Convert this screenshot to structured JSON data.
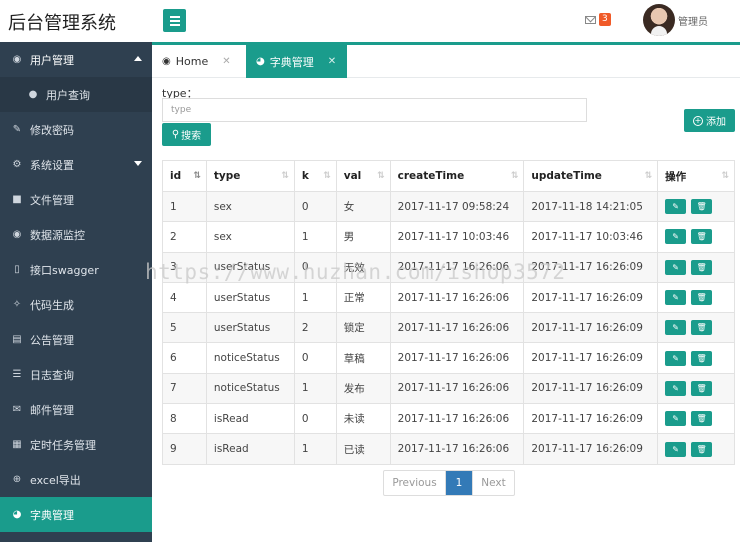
{
  "app": {
    "title": "后台管理系统"
  },
  "header": {
    "mail_count": "3",
    "user_name": "管理员"
  },
  "sidebar": {
    "items": [
      {
        "label": "用户管理",
        "icon": "users-icon",
        "glyph": "👥"
      },
      {
        "label": "用户查询",
        "icon": "user-icon",
        "glyph": "👤"
      },
      {
        "label": "修改密码",
        "icon": "edit-icon",
        "glyph": "✎"
      },
      {
        "label": "系统设置",
        "icon": "gears-icon",
        "glyph": "⚙"
      },
      {
        "label": "文件管理",
        "icon": "folder-icon",
        "glyph": "▰"
      },
      {
        "label": "数据源监控",
        "icon": "eye-icon",
        "glyph": "◉"
      },
      {
        "label": "接口swagger",
        "icon": "file-icon",
        "glyph": "▯"
      },
      {
        "label": "代码生成",
        "icon": "wrench-icon",
        "glyph": "✧"
      },
      {
        "label": "公告管理",
        "icon": "book-icon",
        "glyph": "▤"
      },
      {
        "label": "日志查询",
        "icon": "list-icon",
        "glyph": "☰"
      },
      {
        "label": "邮件管理",
        "icon": "envelope-icon",
        "glyph": "✉"
      },
      {
        "label": "定时任务管理",
        "icon": "calendar-icon",
        "glyph": "▦"
      },
      {
        "label": "excel导出",
        "icon": "plus-circle-icon",
        "glyph": "⊕"
      },
      {
        "label": "字典管理",
        "icon": "dict-icon",
        "glyph": "◍"
      }
    ]
  },
  "tabs": [
    {
      "label": "Home",
      "icon": "dashboard-icon"
    },
    {
      "label": "字典管理",
      "icon": "dict-icon"
    }
  ],
  "search": {
    "label": "type：",
    "placeholder": "type",
    "button": "搜索"
  },
  "add_button": "添加",
  "table": {
    "columns": [
      "id",
      "type",
      "k",
      "val",
      "createTime",
      "updateTime",
      "操作"
    ],
    "rows": [
      [
        "1",
        "sex",
        "0",
        "女",
        "2017-11-17 09:58:24",
        "2017-11-18 14:21:05"
      ],
      [
        "2",
        "sex",
        "1",
        "男",
        "2017-11-17 10:03:46",
        "2017-11-17 10:03:46"
      ],
      [
        "3",
        "userStatus",
        "0",
        "无效",
        "2017-11-17 16:26:06",
        "2017-11-17 16:26:09"
      ],
      [
        "4",
        "userStatus",
        "1",
        "正常",
        "2017-11-17 16:26:06",
        "2017-11-17 16:26:09"
      ],
      [
        "5",
        "userStatus",
        "2",
        "锁定",
        "2017-11-17 16:26:06",
        "2017-11-17 16:26:09"
      ],
      [
        "6",
        "noticeStatus",
        "0",
        "草稿",
        "2017-11-17 16:26:06",
        "2017-11-17 16:26:09"
      ],
      [
        "7",
        "noticeStatus",
        "1",
        "发布",
        "2017-11-17 16:26:06",
        "2017-11-17 16:26:09"
      ],
      [
        "8",
        "isRead",
        "0",
        "未读",
        "2017-11-17 16:26:06",
        "2017-11-17 16:26:09"
      ],
      [
        "9",
        "isRead",
        "1",
        "已读",
        "2017-11-17 16:26:06",
        "2017-11-17 16:26:09"
      ]
    ]
  },
  "pagination": {
    "previous": "Previous",
    "current": "1",
    "next": "Next"
  },
  "watermark": "https://www.huzhan.com/ishop3572"
}
